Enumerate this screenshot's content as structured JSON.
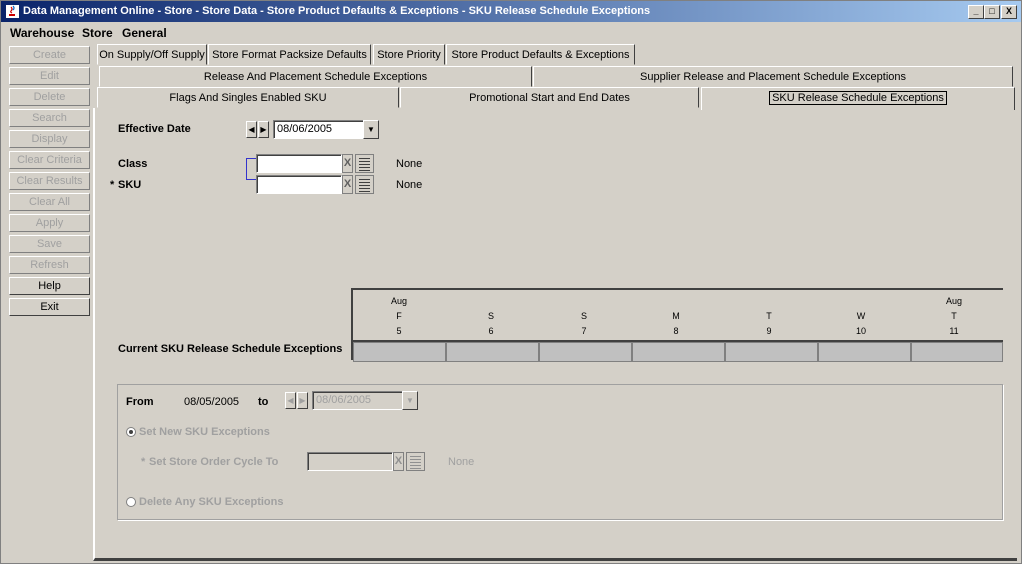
{
  "window": {
    "title": "Data Management Online - Store - Store Data - Store Product Defaults & Exceptions - SKU Release Schedule Exceptions",
    "controls": {
      "minimize": "_",
      "maximize": "□",
      "close": "X"
    }
  },
  "menu": [
    "Warehouse",
    "Store",
    "General"
  ],
  "sidebar": [
    {
      "label": "Create",
      "enabled": false
    },
    {
      "label": "Edit",
      "enabled": false
    },
    {
      "label": "Delete",
      "enabled": false
    },
    {
      "label": "Search",
      "enabled": false
    },
    {
      "label": "Display",
      "enabled": false
    },
    {
      "label": "Clear Criteria",
      "enabled": false
    },
    {
      "label": "Clear Results",
      "enabled": false
    },
    {
      "label": "Clear All",
      "enabled": false
    },
    {
      "label": "Apply",
      "enabled": false
    },
    {
      "label": "Save",
      "enabled": false
    },
    {
      "label": "Refresh",
      "enabled": false
    },
    {
      "label": "Help",
      "enabled": true
    },
    {
      "label": "Exit",
      "enabled": true
    }
  ],
  "tabs_row1": [
    "On Supply/Off Supply",
    "Store Format Packsize Defaults",
    "Store Priority",
    "Store Product Defaults & Exceptions"
  ],
  "tabs_row2": [
    "Release And Placement Schedule Exceptions",
    "Supplier Release and Placement Schedule Exceptions"
  ],
  "tabs_row3": [
    "Flags And Singles Enabled SKU",
    "Promotional Start and End Dates",
    "SKU Release Schedule Exceptions"
  ],
  "form": {
    "effective_date_label": "Effective Date",
    "effective_date": "08/06/2005",
    "class_label": "Class",
    "class_value": "",
    "class_desc": "None",
    "sku_required": "*",
    "sku_label": "SKU",
    "sku_value": "",
    "sku_desc": "None",
    "clear_glyph": "X"
  },
  "calendar": {
    "row_label": "Current SKU Release Schedule Exceptions",
    "days": [
      {
        "month": "Aug",
        "dow": "F",
        "day": "5"
      },
      {
        "month": "",
        "dow": "S",
        "day": "6"
      },
      {
        "month": "",
        "dow": "S",
        "day": "7"
      },
      {
        "month": "",
        "dow": "M",
        "day": "8"
      },
      {
        "month": "",
        "dow": "T",
        "day": "9"
      },
      {
        "month": "",
        "dow": "W",
        "day": "10"
      },
      {
        "month": "Aug",
        "dow": "T",
        "day": "11"
      }
    ]
  },
  "range": {
    "from_label": "From",
    "from_date": "08/05/2005",
    "to_label": "to",
    "to_date": "08/06/2005",
    "set_new_label": "Set New SKU Exceptions",
    "order_cycle_required": "*",
    "order_cycle_label": "Set Store Order Cycle To",
    "order_cycle_value": "",
    "order_cycle_desc": "None",
    "delete_label": "Delete Any SKU Exceptions",
    "selected_option": "set_new"
  }
}
